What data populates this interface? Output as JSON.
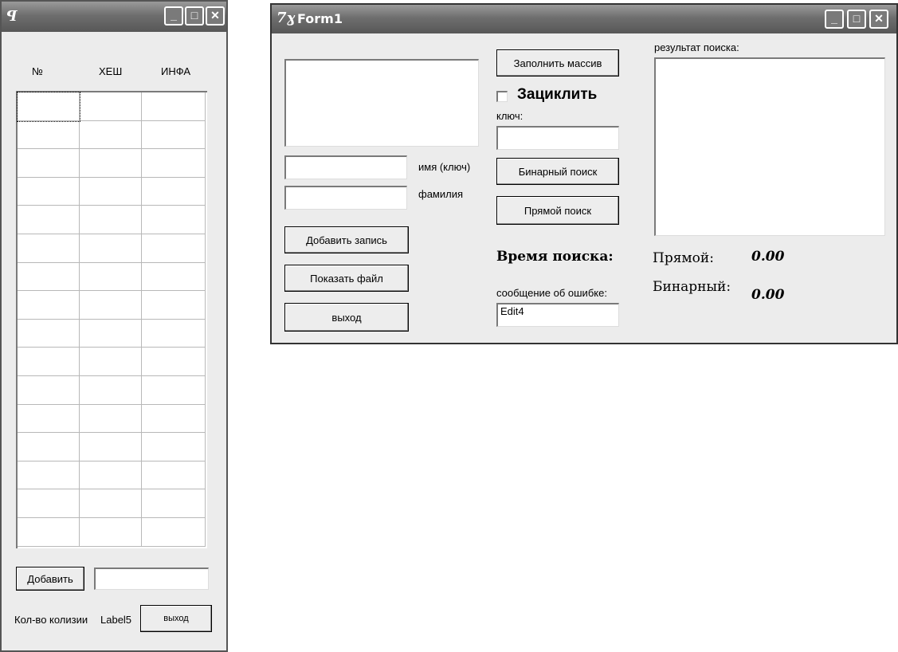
{
  "left_window": {
    "title_icon": "app-icon",
    "columns": [
      "№",
      "ХЕШ",
      "ИНФА"
    ],
    "row_count": 16,
    "add_button": "Добавить",
    "add_input_value": "",
    "collisions_label": "Кол-во колизии",
    "collisions_value": "Label5",
    "exit_button": "выход"
  },
  "form1": {
    "title": "Form1",
    "memo_value": "",
    "name_input_value": "",
    "name_label": "имя (ключ)",
    "surname_input_value": "",
    "surname_label": "фамилия",
    "add_record_button": "Добавить запись",
    "show_file_button": "Показать файл",
    "exit_button": "выход",
    "fill_array_button": "Заполнить массив",
    "loop_checkbox_label": "Зациклить",
    "loop_checked": false,
    "key_label": "ключ:",
    "key_input_value": "",
    "binary_search_button": "Бинарный поиск",
    "direct_search_button": "Прямой поиск",
    "search_time_label": "Время поиска:",
    "error_message_label": "сообщение об ошибке:",
    "error_input_value": "Edit4",
    "result_label": "результат поиска:",
    "direct_label": "Прямой:",
    "direct_time": "0.00",
    "binary_label": "Бинарный:",
    "binary_time": "0.00"
  },
  "titlebar_buttons": {
    "minimize": "_",
    "maximize": "□",
    "close": "✕"
  }
}
